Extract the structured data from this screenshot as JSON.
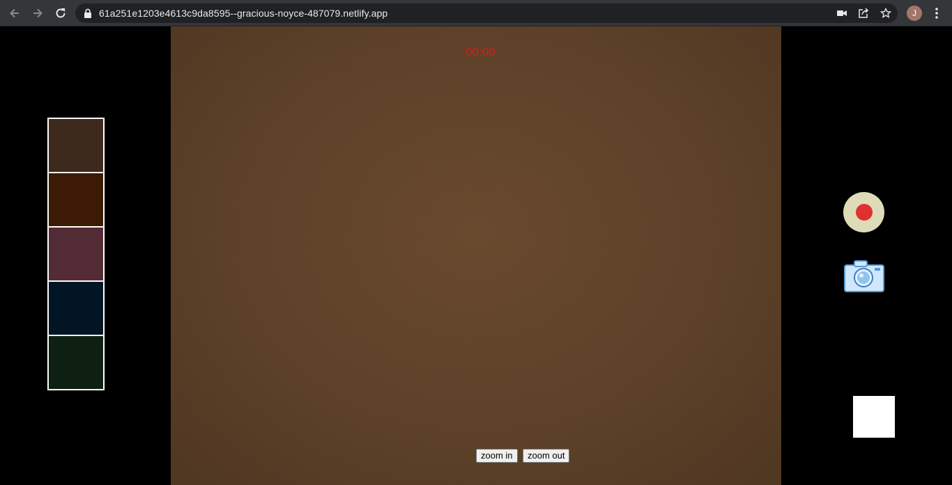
{
  "browser": {
    "url": "61a251e1203e4613c9da8595--gracious-noyce-487079.netlify.app",
    "profile_initial": "J",
    "icons": [
      "back-icon",
      "forward-icon",
      "reload-icon",
      "lock-icon",
      "camera-indicator-icon",
      "share-icon",
      "bookmark-star-icon",
      "kebab-menu-icon"
    ]
  },
  "app": {
    "timer": "00:00",
    "zoom_in_label": "zoom in",
    "zoom_out_label": "zoom out",
    "filters": [
      {
        "color": "#3d2a1d"
      },
      {
        "color": "#3d1a03"
      },
      {
        "color": "#532b34"
      },
      {
        "color": "#021525"
      },
      {
        "color": "#0e2012"
      }
    ],
    "record_color": "#e03131",
    "record_bg": "#dedbb8",
    "timer_color": "#d21f1f"
  }
}
